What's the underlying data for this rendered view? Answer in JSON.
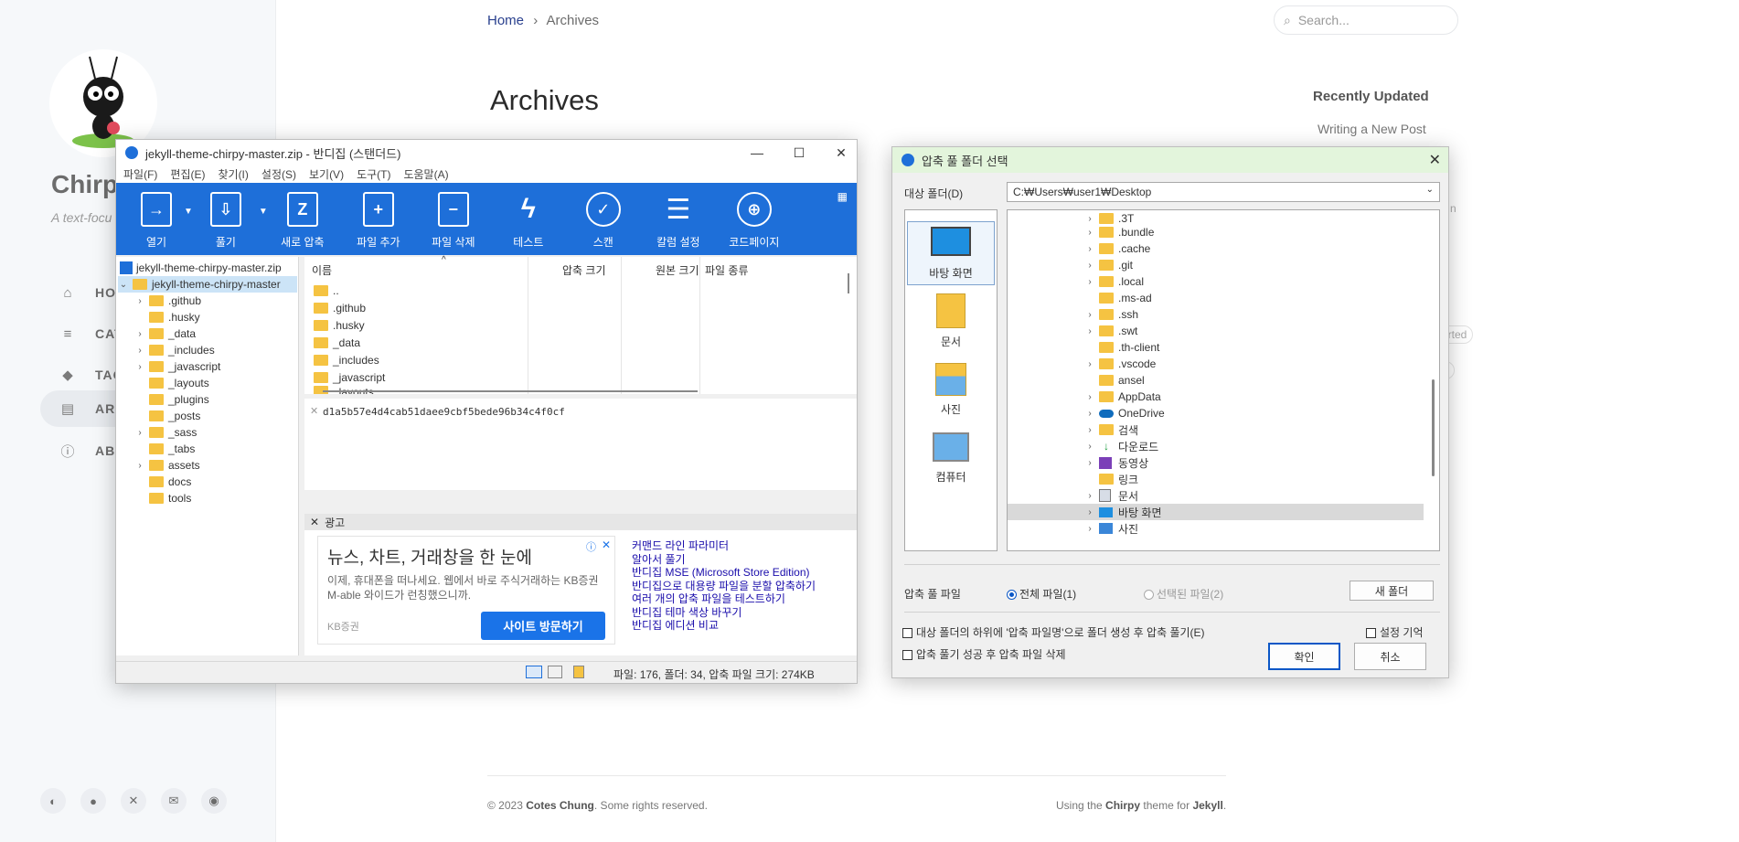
{
  "site": {
    "title": "Chirpy",
    "subtitle": "A text-focu",
    "nav": [
      {
        "label": "HO",
        "icon": "home-icon"
      },
      {
        "label": "CAT",
        "icon": "list-icon"
      },
      {
        "label": "TAG",
        "icon": "tags-icon"
      },
      {
        "label": "ARC",
        "icon": "archive-icon"
      },
      {
        "label": "ABO",
        "icon": "info-icon"
      }
    ]
  },
  "breadcrumb": {
    "home": "Home",
    "sep": "›",
    "current": "Archives"
  },
  "search": {
    "placeholder": "Search..."
  },
  "page_title": "Archives",
  "recently": {
    "title": "Recently Updated",
    "item": "Writing a New Post",
    "frag1": "n",
    "frag2": "orted",
    "frag3": "g"
  },
  "footer": {
    "copy": "© 2023",
    "author": "Cotes Chung",
    "rights": ". Some rights reserved.",
    "using": "Using the",
    "theme": "Chirpy",
    "theme_for": "theme for",
    "jekyll": "Jekyll",
    "dot": "."
  },
  "bandizip": {
    "title": "jekyll-theme-chirpy-master.zip - 반디집 (스탠더드)",
    "menu": [
      "파일(F)",
      "편집(E)",
      "찾기(I)",
      "설정(S)",
      "보기(V)",
      "도구(T)",
      "도움말(A)"
    ],
    "toolbar": [
      "열기",
      "풀기",
      "새로 압축",
      "파일 추가",
      "파일 삭제",
      "테스트",
      "스캔",
      "칼럼 설정",
      "코드페이지"
    ],
    "tree_root": "jekyll-theme-chirpy-master.zip",
    "tree_folder": "jekyll-theme-chirpy-master",
    "tree_items": [
      ".github",
      ".husky",
      "_data",
      "_includes",
      "_javascript",
      "_layouts",
      "_plugins",
      "_posts",
      "_sass",
      "_tabs",
      "assets",
      "docs",
      "tools"
    ],
    "columns": {
      "name": "이름",
      "packed": "압축 크기",
      "original": "원본 크기",
      "type": "파일 종류"
    },
    "files": [
      "..",
      ".github",
      ".husky",
      "_data",
      "_includes",
      "_javascript",
      "_layouts"
    ],
    "hash": "d1a5b57e4d4cab51daee9cbf5bede96b34c4f0cf",
    "ad_label": "광고",
    "ad": {
      "headline": "뉴스, 차트, 거래창을 한 눈에",
      "text": "이제, 휴대폰을 떠나세요. 웹에서 바로 주식거래하는 KB증권 M-able 와이드가 런칭했으니까.",
      "source": "KB증권",
      "button": "사이트 방문하기",
      "links": [
        "커맨드 라인 파라미터",
        "알아서 풀기",
        "반디집 MSE (Microsoft Store Edition)",
        "반디집으로 대용량 파일을 분할 압축하기",
        "여러 개의 압축 파일을 테스트하기",
        "반디집 테마 색상 바꾸기",
        "반디집 에디션 비교"
      ]
    },
    "status": "파일: 176, 폴더: 34, 압축 파일 크기: 274KB"
  },
  "dialog": {
    "title": "압축 풀 폴더 선택",
    "target_label": "대상 폴더(D)",
    "path": "C:₩Users₩user1₩Desktop",
    "places": [
      "바탕 화면",
      "문서",
      "사진",
      "컴퓨터"
    ],
    "folders": [
      ".3T",
      ".bundle",
      ".cache",
      ".git",
      ".local",
      ".ms-ad",
      ".ssh",
      ".swt",
      ".th-client",
      ".vscode",
      "ansel",
      "AppData",
      "OneDrive",
      "검색",
      "다운로드",
      "동영상",
      "링크",
      "문서",
      "바탕 화면",
      "사진"
    ],
    "extract_label": "압축 풀 파일",
    "all_files": "전체 파일(1)",
    "selected_files": "선택된 파일(2)",
    "new_folder": "새 폴더",
    "opt1": "대상 폴더의 하위에 '압축 파일명'으로 폴더 생성 후 압축 풀기(E)",
    "opt2": "압축 풀기 성공 후 압축 파일 삭제",
    "remember": "설정 기억",
    "ok": "확인",
    "cancel": "취소"
  },
  "colors": {
    "accent": "#1e6fd9",
    "link": "#2a408e",
    "dialog_title": "#e3f5dc"
  }
}
